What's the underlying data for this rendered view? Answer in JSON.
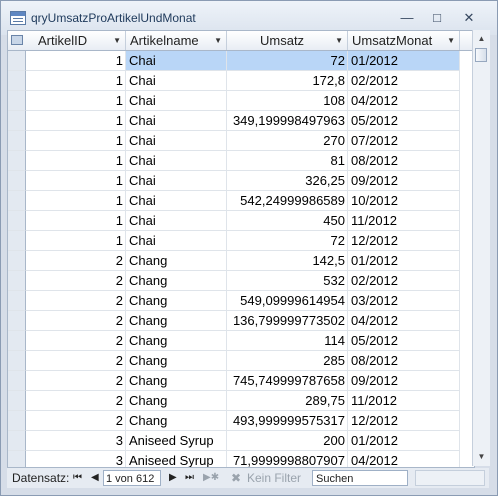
{
  "window": {
    "title": "qryUmsatzProArtikelUndMonat",
    "controls": [
      "minimize-icon",
      "restore-icon",
      "close-icon"
    ]
  },
  "columns": [
    "ArtikelID",
    "Artikelname",
    "Umsatz",
    "UmsatzMonat"
  ],
  "rows": [
    {
      "id": "1",
      "name": "Chai",
      "umsatz": "72",
      "monat": "01/2012"
    },
    {
      "id": "1",
      "name": "Chai",
      "umsatz": "172,8",
      "monat": "02/2012"
    },
    {
      "id": "1",
      "name": "Chai",
      "umsatz": "108",
      "monat": "04/2012"
    },
    {
      "id": "1",
      "name": "Chai",
      "umsatz": "349,199998497963",
      "monat": "05/2012"
    },
    {
      "id": "1",
      "name": "Chai",
      "umsatz": "270",
      "monat": "07/2012"
    },
    {
      "id": "1",
      "name": "Chai",
      "umsatz": "81",
      "monat": "08/2012"
    },
    {
      "id": "1",
      "name": "Chai",
      "umsatz": "326,25",
      "monat": "09/2012"
    },
    {
      "id": "1",
      "name": "Chai",
      "umsatz": "542,24999986589",
      "monat": "10/2012"
    },
    {
      "id": "1",
      "name": "Chai",
      "umsatz": "450",
      "monat": "11/2012"
    },
    {
      "id": "1",
      "name": "Chai",
      "umsatz": "72",
      "monat": "12/2012"
    },
    {
      "id": "2",
      "name": "Chang",
      "umsatz": "142,5",
      "monat": "01/2012"
    },
    {
      "id": "2",
      "name": "Chang",
      "umsatz": "532",
      "monat": "02/2012"
    },
    {
      "id": "2",
      "name": "Chang",
      "umsatz": "549,09999614954",
      "monat": "03/2012"
    },
    {
      "id": "2",
      "name": "Chang",
      "umsatz": "136,799999773502",
      "monat": "04/2012"
    },
    {
      "id": "2",
      "name": "Chang",
      "umsatz": "114",
      "monat": "05/2012"
    },
    {
      "id": "2",
      "name": "Chang",
      "umsatz": "285",
      "monat": "08/2012"
    },
    {
      "id": "2",
      "name": "Chang",
      "umsatz": "745,749999787658",
      "monat": "09/2012"
    },
    {
      "id": "2",
      "name": "Chang",
      "umsatz": "289,75",
      "monat": "11/2012"
    },
    {
      "id": "2",
      "name": "Chang",
      "umsatz": "493,999999575317",
      "monat": "12/2012"
    },
    {
      "id": "3",
      "name": "Aniseed Syrup",
      "umsatz": "200",
      "monat": "01/2012"
    },
    {
      "id": "3",
      "name": "Aniseed Syrup",
      "umsatz": "71,9999998807907",
      "monat": "04/2012"
    }
  ],
  "status": {
    "label": "Datensatz:",
    "first": "⏮",
    "prev": "◀",
    "record": "1 von 612",
    "next": "▶",
    "last": "⏭",
    "new": "▶✱",
    "filter": "Kein Filter",
    "search_placeholder": "Suchen"
  },
  "colors": {
    "selected_row": "#b9d6f7",
    "title_text": "#1e395b"
  }
}
